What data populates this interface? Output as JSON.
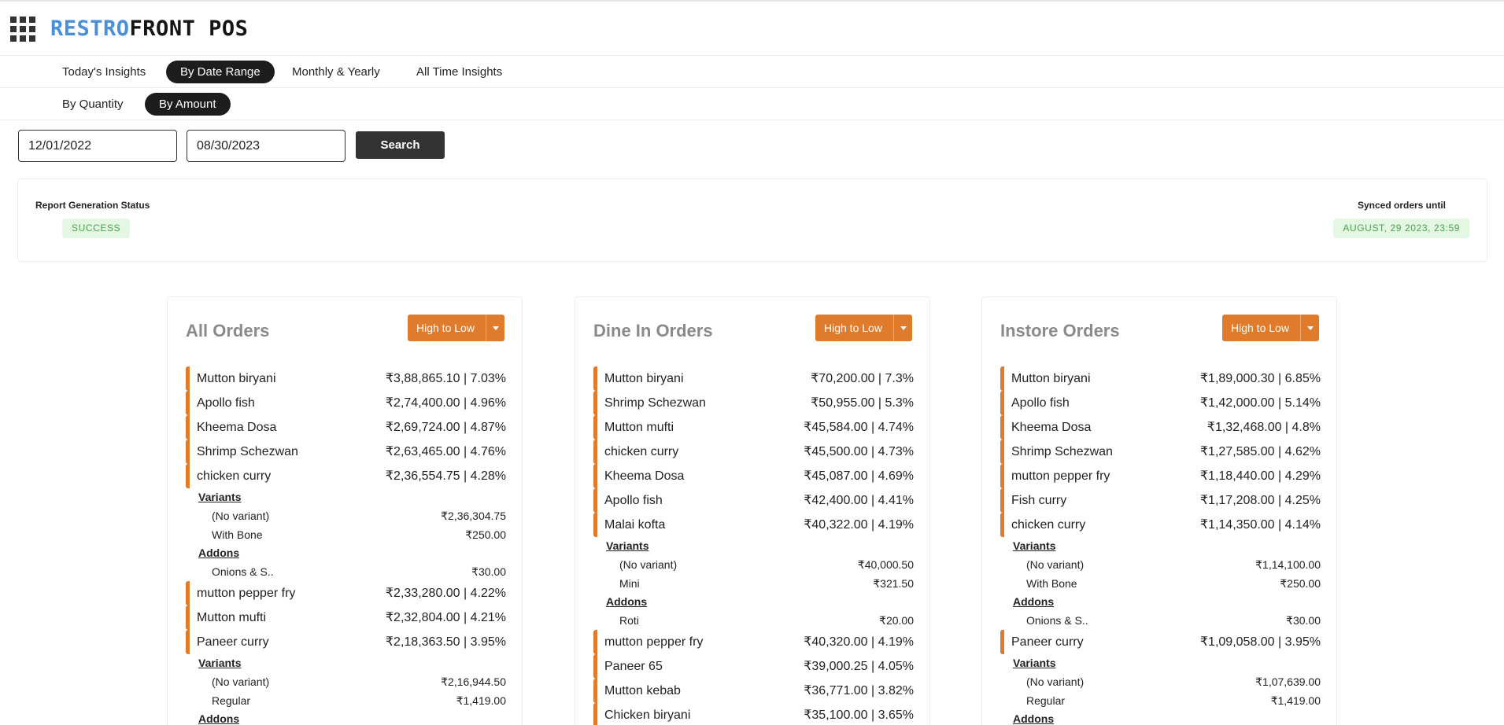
{
  "app": {
    "logo_part1": "RESTRO",
    "logo_part2": "FRONT POS",
    "menu_icon": "apps-grid-icon"
  },
  "insight_tabs": [
    {
      "label": "Today's Insights",
      "active": false
    },
    {
      "label": "By Date Range",
      "active": true
    },
    {
      "label": "Monthly & Yearly",
      "active": false
    },
    {
      "label": "All Time Insights",
      "active": false
    }
  ],
  "metric_tabs": [
    {
      "label": "By Quantity",
      "active": false
    },
    {
      "label": "By Amount",
      "active": true
    }
  ],
  "date_range": {
    "from": "12/01/2022",
    "to": "08/30/2023",
    "search_label": "Search"
  },
  "status": {
    "report_label": "Report Generation Status",
    "report_value": "SUCCESS",
    "synced_label": "Synced orders until",
    "synced_value": "AUGUST, 29 2023, 23:59"
  },
  "colors": {
    "accent": "#e07b2b",
    "dark": "#1d1d1d",
    "success_bg": "#e3f7e3",
    "success_text": "#4aa34a",
    "logo_blue": "#4a90d9"
  },
  "cards": [
    {
      "title": "All Orders",
      "sort_label": "High to Low",
      "rows": [
        {
          "type": "item",
          "name": "Mutton biryani",
          "value": "₹3,88,865.10 | 7.03%"
        },
        {
          "type": "item",
          "name": "Apollo fish",
          "value": "₹2,74,400.00 | 4.96%"
        },
        {
          "type": "item",
          "name": "Kheema Dosa",
          "value": "₹2,69,724.00 | 4.87%"
        },
        {
          "type": "item",
          "name": "Shrimp Schezwan",
          "value": "₹2,63,465.00 | 4.76%"
        },
        {
          "type": "item",
          "name": "chicken curry",
          "value": "₹2,36,554.75 | 4.28%"
        },
        {
          "type": "header",
          "name": "Variants"
        },
        {
          "type": "sub",
          "name": "(No variant)",
          "value": "₹2,36,304.75"
        },
        {
          "type": "sub",
          "name": "With Bone",
          "value": "₹250.00"
        },
        {
          "type": "header",
          "name": "Addons"
        },
        {
          "type": "sub",
          "name": "Onions & S..",
          "value": "₹30.00"
        },
        {
          "type": "item",
          "name": "mutton pepper fry",
          "value": "₹2,33,280.00 | 4.22%"
        },
        {
          "type": "item",
          "name": "Mutton mufti",
          "value": "₹2,32,804.00 | 4.21%"
        },
        {
          "type": "item",
          "name": "Paneer curry",
          "value": "₹2,18,363.50 | 3.95%"
        },
        {
          "type": "header",
          "name": "Variants"
        },
        {
          "type": "sub",
          "name": "(No variant)",
          "value": "₹2,16,944.50"
        },
        {
          "type": "sub",
          "name": "Regular",
          "value": "₹1,419.00"
        },
        {
          "type": "header",
          "name": "Addons"
        }
      ]
    },
    {
      "title": "Dine In Orders",
      "sort_label": "High to Low",
      "rows": [
        {
          "type": "item",
          "name": "Mutton biryani",
          "value": "₹70,200.00 | 7.3%"
        },
        {
          "type": "item",
          "name": "Shrimp Schezwan",
          "value": "₹50,955.00 | 5.3%"
        },
        {
          "type": "item",
          "name": "Mutton mufti",
          "value": "₹45,584.00 | 4.74%"
        },
        {
          "type": "item",
          "name": "chicken curry",
          "value": "₹45,500.00 | 4.73%"
        },
        {
          "type": "item",
          "name": "Kheema Dosa",
          "value": "₹45,087.00 | 4.69%"
        },
        {
          "type": "item",
          "name": "Apollo fish",
          "value": "₹42,400.00 | 4.41%"
        },
        {
          "type": "item",
          "name": "Malai kofta",
          "value": "₹40,322.00 | 4.19%"
        },
        {
          "type": "header",
          "name": "Variants"
        },
        {
          "type": "sub",
          "name": "(No variant)",
          "value": "₹40,000.50"
        },
        {
          "type": "sub",
          "name": "Mini",
          "value": "₹321.50"
        },
        {
          "type": "header",
          "name": "Addons"
        },
        {
          "type": "sub",
          "name": "Roti",
          "value": "₹20.00"
        },
        {
          "type": "item",
          "name": "mutton pepper fry",
          "value": "₹40,320.00 | 4.19%"
        },
        {
          "type": "item",
          "name": "Paneer 65",
          "value": "₹39,000.25 | 4.05%"
        },
        {
          "type": "item",
          "name": "Mutton kebab",
          "value": "₹36,771.00 | 3.82%"
        },
        {
          "type": "item",
          "name": "Chicken biryani",
          "value": "₹35,100.00 | 3.65%"
        }
      ]
    },
    {
      "title": "Instore Orders",
      "sort_label": "High to Low",
      "rows": [
        {
          "type": "item",
          "name": "Mutton biryani",
          "value": "₹1,89,000.30 | 6.85%"
        },
        {
          "type": "item",
          "name": "Apollo fish",
          "value": "₹1,42,000.00 | 5.14%"
        },
        {
          "type": "item",
          "name": "Kheema Dosa",
          "value": "₹1,32,468.00 | 4.8%"
        },
        {
          "type": "item",
          "name": "Shrimp Schezwan",
          "value": "₹1,27,585.00 | 4.62%"
        },
        {
          "type": "item",
          "name": "mutton pepper fry",
          "value": "₹1,18,440.00 | 4.29%"
        },
        {
          "type": "item",
          "name": "Fish curry",
          "value": "₹1,17,208.00 | 4.25%"
        },
        {
          "type": "item",
          "name": "chicken curry",
          "value": "₹1,14,350.00 | 4.14%"
        },
        {
          "type": "header",
          "name": "Variants"
        },
        {
          "type": "sub",
          "name": "(No variant)",
          "value": "₹1,14,100.00"
        },
        {
          "type": "sub",
          "name": "With Bone",
          "value": "₹250.00"
        },
        {
          "type": "header",
          "name": "Addons"
        },
        {
          "type": "sub",
          "name": "Onions & S..",
          "value": "₹30.00"
        },
        {
          "type": "item",
          "name": "Paneer curry",
          "value": "₹1,09,058.00 | 3.95%"
        },
        {
          "type": "header",
          "name": "Variants"
        },
        {
          "type": "sub",
          "name": "(No variant)",
          "value": "₹1,07,639.00"
        },
        {
          "type": "sub",
          "name": "Regular",
          "value": "₹1,419.00"
        },
        {
          "type": "header",
          "name": "Addons"
        }
      ]
    }
  ]
}
